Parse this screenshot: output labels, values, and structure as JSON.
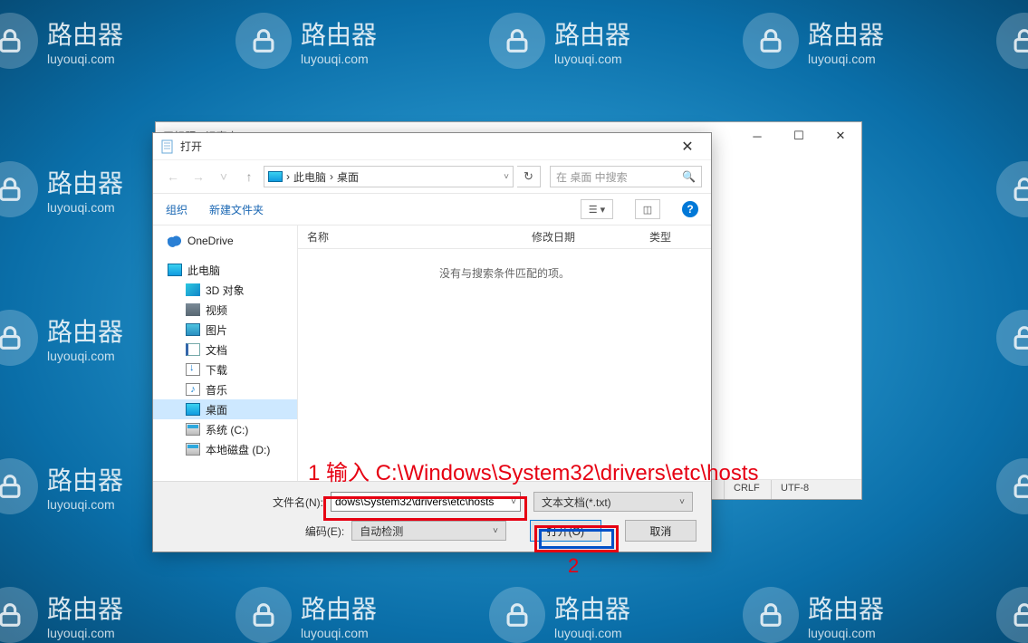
{
  "watermark": {
    "cn": "路由器",
    "lat": "luyouqi.com"
  },
  "notepad": {
    "title": "无标题 - 记事本",
    "status_crlf": "CRLF",
    "status_enc": "UTF-8"
  },
  "dialog": {
    "title": "打开",
    "nav": {
      "crumb_root": "此电脑",
      "crumb_leaf": "桌面"
    },
    "search_placeholder": "在 桌面 中搜索",
    "toolbar": {
      "organize": "组织",
      "newfolder": "新建文件夹"
    },
    "columns": {
      "name": "名称",
      "modified": "修改日期",
      "type": "类型"
    },
    "empty_msg": "没有与搜索条件匹配的项。",
    "tree": {
      "onedrive": "OneDrive",
      "thispc": "此电脑",
      "items": [
        "3D 对象",
        "视频",
        "图片",
        "文档",
        "下载",
        "音乐",
        "桌面",
        "系统 (C:)",
        "本地磁盘 (D:)"
      ]
    },
    "filename_label": "文件名(N):",
    "filename_value": "dows\\System32\\drivers\\etc\\hosts",
    "filetype_label": "文本文档(*.txt)",
    "encoding_label": "编码(E):",
    "encoding_value": "自动检测",
    "open_btn": "打开(O)",
    "cancel_btn": "取消"
  },
  "annotations": {
    "step1": "1 输入 C:\\Windows\\System32\\drivers\\etc\\hosts",
    "step2": "2"
  }
}
